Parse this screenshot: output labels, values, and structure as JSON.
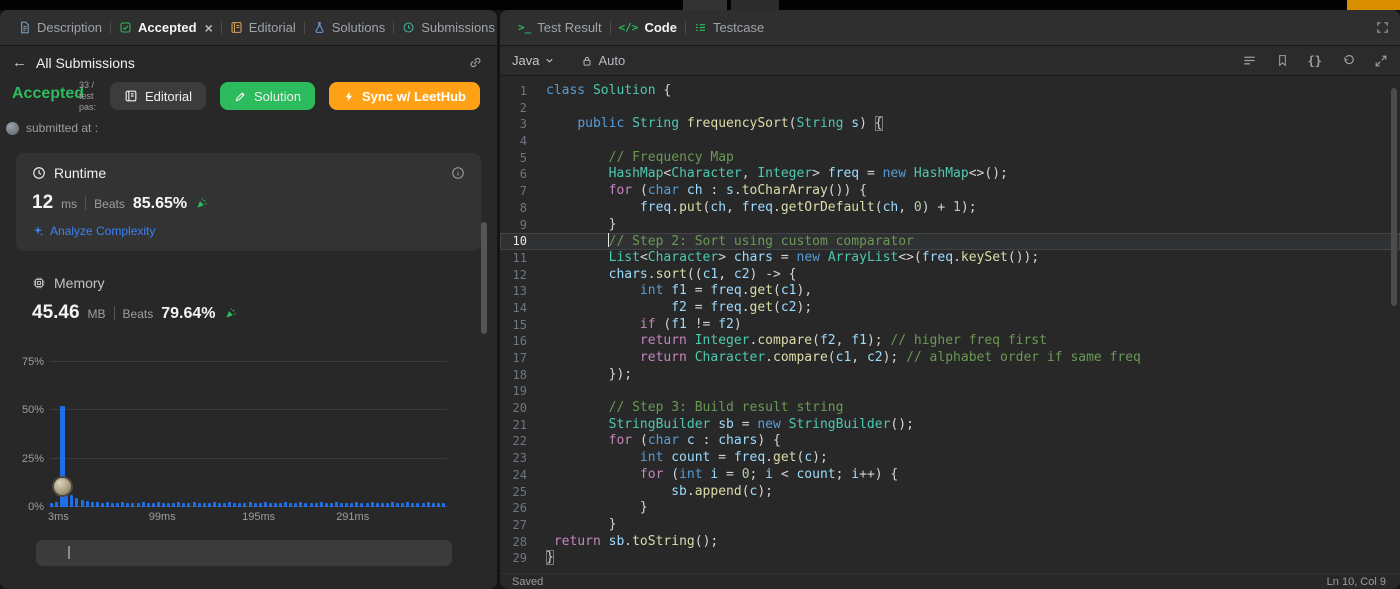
{
  "colors": {
    "accent_green": "#2cbb5d",
    "accent_orange": "#ffa116",
    "link_blue": "#3b82f6",
    "bar_blue": "#1f6feb"
  },
  "left_panel": {
    "tabs": [
      {
        "label": "Description"
      },
      {
        "label": "Accepted"
      },
      {
        "label": "Editorial"
      },
      {
        "label": "Solutions"
      },
      {
        "label": "Submissions"
      }
    ],
    "back_link": "All Submissions",
    "result": {
      "status": "Accepted",
      "stats": [
        "33 /",
        "test",
        "pas:"
      ],
      "submitted": "submitted at :"
    },
    "buttons": {
      "editorial": "Editorial",
      "solution": "Solution",
      "sync": "Sync w/ LeetHub"
    },
    "runtime": {
      "title": "Runtime",
      "value": "12",
      "unit": "ms",
      "beats_label": "Beats",
      "beats_value": "85.65%",
      "analyze": "Analyze Complexity"
    },
    "memory": {
      "title": "Memory",
      "value": "45.46",
      "unit": "MB",
      "beats_label": "Beats",
      "beats_value": "79.64%"
    }
  },
  "chart_data": {
    "type": "bar",
    "ylim": [
      0,
      80
    ],
    "y_ticks": [
      {
        "label": "75%",
        "value": 75
      },
      {
        "label": "50%",
        "value": 50
      },
      {
        "label": "25%",
        "value": 25
      },
      {
        "label": "0%",
        "value": 0
      }
    ],
    "x_ticks": [
      {
        "label": "3ms",
        "pos": 0
      },
      {
        "label": "99ms",
        "pos": 0.264
      },
      {
        "label": "195ms",
        "pos": 0.499
      },
      {
        "label": "291ms",
        "pos": 0.736
      }
    ],
    "highlight_index": 2,
    "marker_index": 2,
    "values": [
      2,
      2.5,
      52,
      10,
      6,
      4.5,
      3.5,
      3,
      2.5,
      2.5,
      2,
      2.5,
      2,
      2,
      2.5,
      2,
      2,
      2,
      2.5,
      2,
      2,
      2.5,
      2,
      2,
      2,
      2.5,
      2,
      2,
      2.5,
      2,
      2,
      2,
      2.5,
      2,
      2,
      2.5,
      2,
      2,
      2,
      2.5,
      2,
      2,
      2.5,
      2,
      2,
      2,
      2.5,
      2,
      2,
      2.5,
      2,
      2,
      2,
      2.5,
      2,
      2,
      2.5,
      2,
      2,
      2,
      2.5,
      2,
      2,
      2.5,
      2,
      2,
      2,
      2.5,
      2,
      2,
      2.5,
      2,
      2,
      2,
      2.5,
      2,
      2,
      2
    ]
  },
  "editor": {
    "tabs": [
      {
        "label": "Test Result"
      },
      {
        "label": "Code"
      },
      {
        "label": "Testcase"
      }
    ],
    "language": "Java",
    "mode": "Auto",
    "status_saved": "Saved",
    "status_position": "Ln 10, Col 9",
    "cursor": {
      "line": 10,
      "col": 9
    },
    "bracket_match_lines": [
      3,
      29
    ],
    "code_lines": [
      "class Solution {",
      "",
      "    public String frequencySort(String s) {",
      "",
      "        // Frequency Map",
      "        HashMap<Character, Integer> freq = new HashMap<>();",
      "        for (char ch : s.toCharArray()) {",
      "            freq.put(ch, freq.getOrDefault(ch, 0) + 1);",
      "        }",
      "        // Step 2: Sort using custom comparator",
      "        List<Character> chars = new ArrayList<>(freq.keySet());",
      "        chars.sort((c1, c2) -> {",
      "            int f1 = freq.get(c1),",
      "                f2 = freq.get(c2);",
      "            if (f1 != f2)",
      "            return Integer.compare(f2, f1); // higher freq first",
      "            return Character.compare(c1, c2); // alphabet order if same freq",
      "        });",
      "",
      "        // Step 3: Build result string",
      "        StringBuilder sb = new StringBuilder();",
      "        for (char c : chars) {",
      "            int count = freq.get(c);",
      "            for (int i = 0; i < count; i++) {",
      "                sb.append(c);",
      "            }",
      "        }",
      " return sb.toString();",
      "}"
    ]
  }
}
